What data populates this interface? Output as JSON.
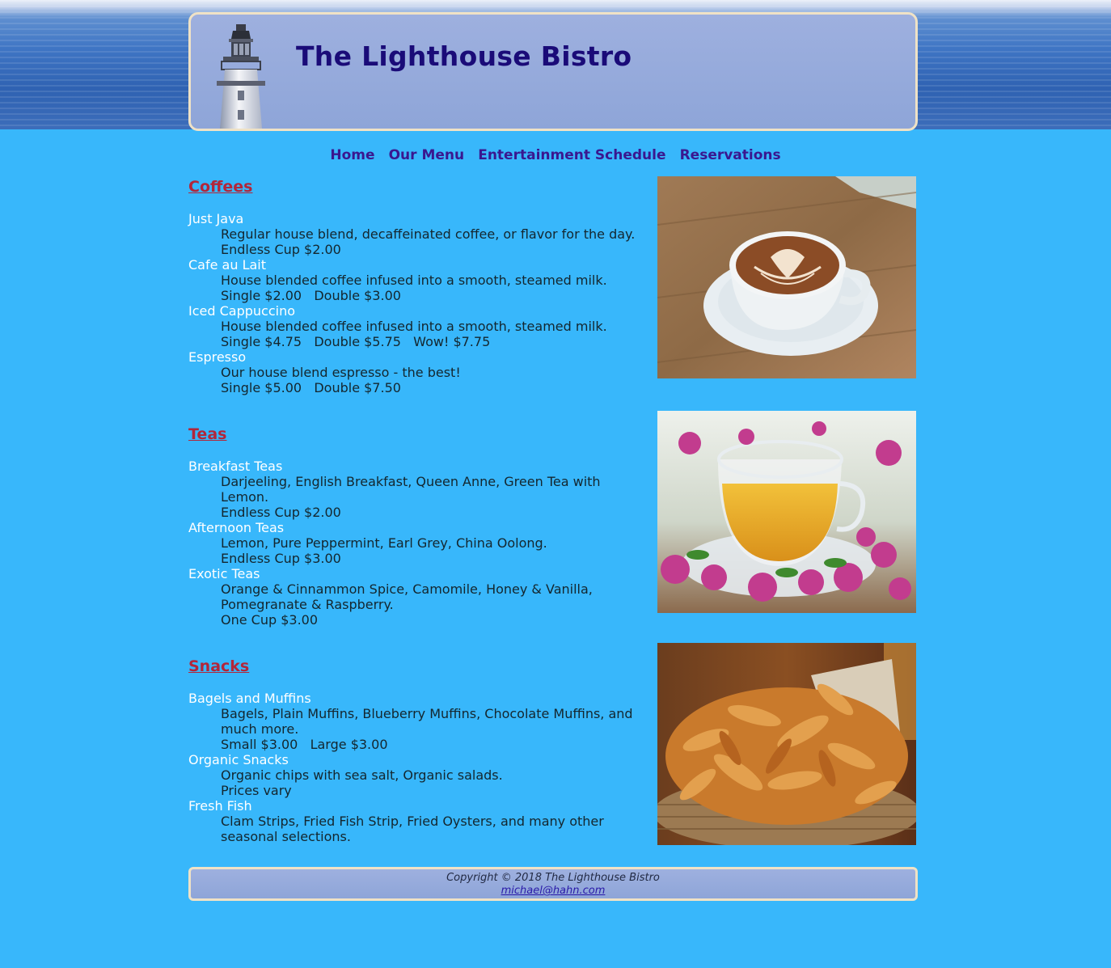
{
  "header": {
    "title": "The Lighthouse Bistro"
  },
  "nav": [
    {
      "label": "Home"
    },
    {
      "label": "Our Menu"
    },
    {
      "label": "Entertainment Schedule"
    },
    {
      "label": "Reservations"
    }
  ],
  "sections": [
    {
      "title": "Coffees",
      "items": [
        {
          "name": "Just Java",
          "lines": [
            "Regular house blend, decaffeinated coffee, or flavor for the day.",
            "Endless Cup $2.00"
          ]
        },
        {
          "name": "Cafe au Lait",
          "lines": [
            "House blended coffee infused into a smooth, steamed milk.",
            "Single $2.00   Double $3.00"
          ]
        },
        {
          "name": "Iced Cappuccino",
          "lines": [
            "House blended coffee infused into a smooth, steamed milk.",
            "Single $4.75   Double $5.75   Wow! $7.75"
          ]
        },
        {
          "name": "Espresso",
          "lines": [
            "Our house blend espresso - the best!",
            "Single $5.00   Double $7.50"
          ]
        }
      ]
    },
    {
      "title": "Teas",
      "items": [
        {
          "name": "Breakfast Teas",
          "lines": [
            "Darjeeling, English Breakfast, Queen Anne, Green Tea with",
            "Lemon.",
            "Endless Cup $2.00"
          ]
        },
        {
          "name": "Afternoon Teas",
          "lines": [
            "Lemon, Pure Peppermint, Earl Grey, China Oolong.",
            "Endless Cup $3.00"
          ]
        },
        {
          "name": "Exotic Teas",
          "lines": [
            "Orange & Cinnammon Spice, Camomile, Honey & Vanilla,",
            "Pomegranate & Raspberry.",
            "One Cup $3.00"
          ]
        }
      ]
    },
    {
      "title": "Snacks",
      "items": [
        {
          "name": "Bagels and Muffins",
          "lines": [
            "Bagels, Plain Muffins, Blueberry Muffins, Chocolate Muffins, and",
            "much more.",
            "Small $3.00   Large $3.00"
          ]
        },
        {
          "name": "Organic Snacks",
          "lines": [
            "Organic chips with sea salt, Organic salads.",
            "Prices vary"
          ]
        },
        {
          "name": "Fresh Fish",
          "lines": [
            "Clam Strips, Fried Fish Strip, Fried Oysters, and many other",
            "seasonal selections."
          ]
        }
      ]
    }
  ],
  "footer": {
    "copyright": "Copyright © 2018 The Lighthouse Bistro",
    "email": "michael@hahn.com"
  },
  "colors": {
    "background": "#38b7fb",
    "title": "#1a0b78",
    "nav": "#3a178f",
    "section_heading": "#b2263a",
    "item_name": "#ffffff"
  }
}
